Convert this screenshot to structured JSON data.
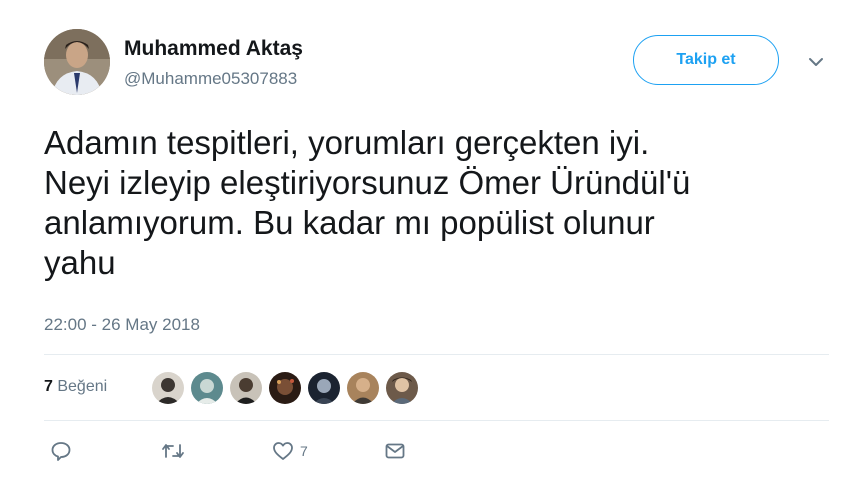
{
  "tweet": {
    "display_name": "Muhammed Aktaş",
    "handle": "@Muhamme05307883",
    "follow_label": "Takip et",
    "text": "Adamın tespitleri, yorumları gerçekten iyi.\nNeyi izleyip eleştiriyorsunuz Ömer Üründül'ü\nanlamıyorum. Bu kadar mı popülist olunur\nyahu",
    "timestamp": "22:00 - 26 May 2018",
    "likes": {
      "count": "7",
      "label": "Beğeni"
    },
    "liker_avatars": [
      "liker-1",
      "liker-2",
      "liker-3",
      "liker-4",
      "liker-5",
      "liker-6",
      "liker-7"
    ],
    "actions": {
      "reply_icon": "reply-icon",
      "retweet_icon": "retweet-icon",
      "like_icon": "heart-icon",
      "like_count": "7",
      "dm_icon": "envelope-icon"
    }
  },
  "colors": {
    "accent": "#1da1f2",
    "text": "#14171a",
    "muted": "#657786",
    "divider": "#e6ecf0"
  }
}
